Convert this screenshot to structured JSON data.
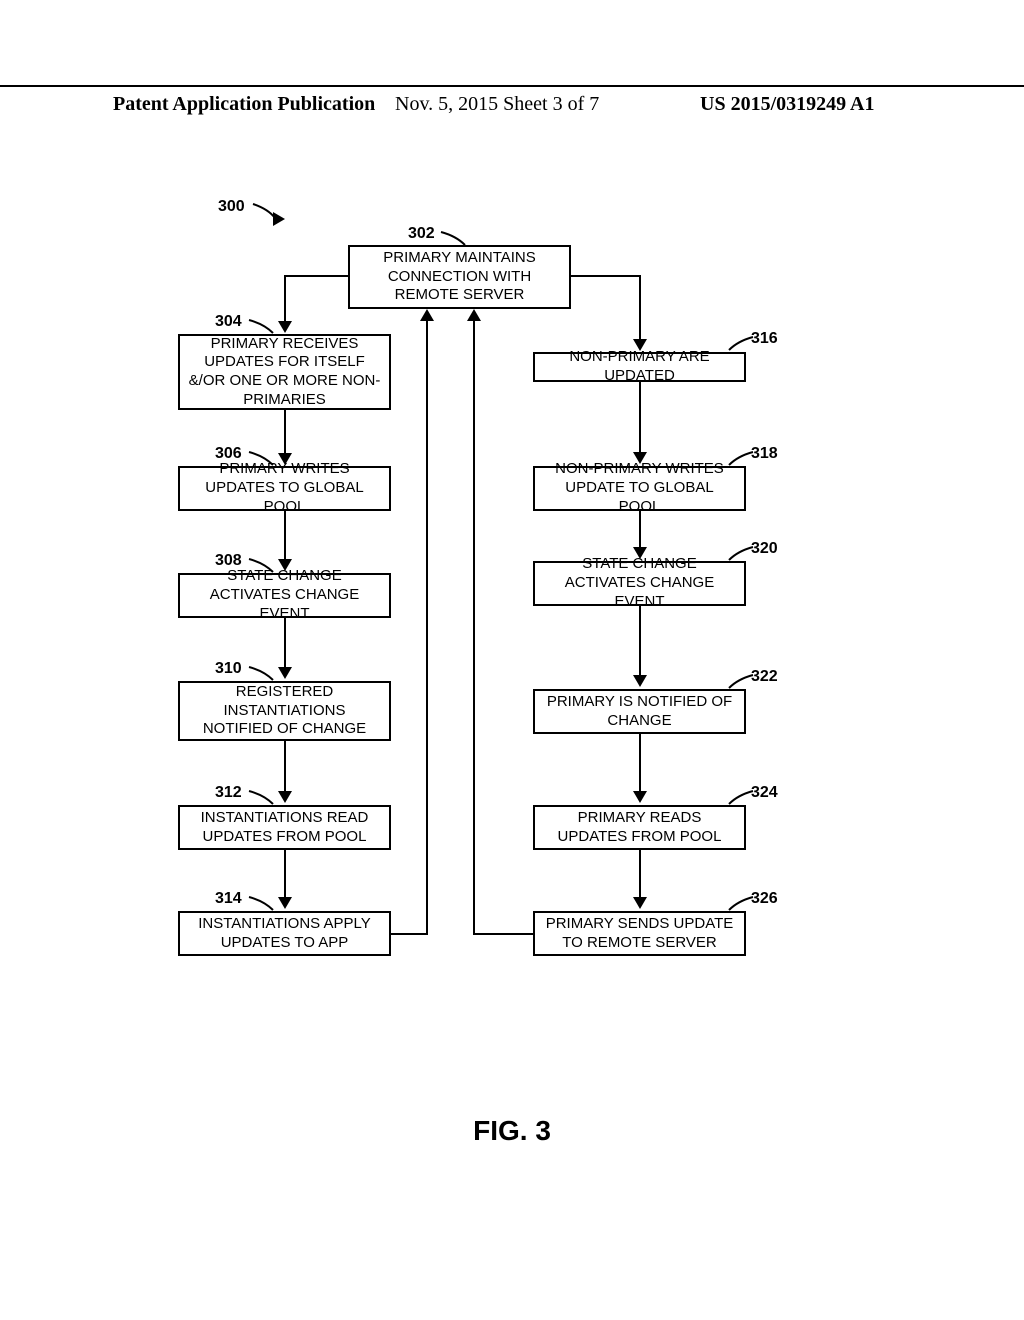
{
  "header": {
    "left": "Patent Application Publication",
    "mid": "Nov. 5, 2015   Sheet 3 of 7",
    "right": "US 2015/0319249 A1"
  },
  "labels": {
    "l300": "300",
    "l302": "302",
    "l304": "304",
    "l306": "306",
    "l308": "308",
    "l310": "310",
    "l312": "312",
    "l314": "314",
    "l316": "316",
    "l318": "318",
    "l320": "320",
    "l322": "322",
    "l324": "324",
    "l326": "326"
  },
  "boxes": {
    "b302": "PRIMARY MAINTAINS CONNECTION WITH REMOTE SERVER",
    "b304": "PRIMARY RECEIVES UPDATES FOR ITSELF &/OR ONE OR MORE NON-PRIMARIES",
    "b306": "PRIMARY WRITES UPDATES TO GLOBAL POOL",
    "b308": "STATE CHANGE ACTIVATES CHANGE EVENT",
    "b310": "REGISTERED INSTANTIATIONS NOTIFIED OF CHANGE",
    "b312": "INSTANTIATIONS READ UPDATES FROM POOL",
    "b314": "INSTANTIATIONS APPLY UPDATES TO APP",
    "b316": "NON-PRIMARY ARE UPDATED",
    "b318": "NON-PRIMARY WRITES UPDATE TO GLOBAL POOL",
    "b320": "STATE CHANGE ACTIVATES CHANGE EVENT",
    "b322": "PRIMARY IS NOTIFIED OF CHANGE",
    "b324": "PRIMARY READS UPDATES FROM POOL",
    "b326": "PRIMARY SENDS UPDATE TO REMOTE SERVER"
  },
  "caption": "FIG. 3",
  "chart_data": {
    "type": "flowchart",
    "title": "FIG. 3",
    "root_label_ref": "300",
    "root_node": "302",
    "nodes": [
      {
        "id": "302",
        "text": "PRIMARY MAINTAINS CONNECTION WITH REMOTE SERVER"
      },
      {
        "id": "304",
        "text": "PRIMARY RECEIVES UPDATES FOR ITSELF &/OR ONE OR MORE NON-PRIMARIES"
      },
      {
        "id": "306",
        "text": "PRIMARY WRITES UPDATES TO GLOBAL POOL"
      },
      {
        "id": "308",
        "text": "STATE CHANGE ACTIVATES CHANGE EVENT"
      },
      {
        "id": "310",
        "text": "REGISTERED INSTANTIATIONS NOTIFIED OF CHANGE"
      },
      {
        "id": "312",
        "text": "INSTANTIATIONS READ UPDATES FROM POOL"
      },
      {
        "id": "314",
        "text": "INSTANTIATIONS APPLY UPDATES TO APP"
      },
      {
        "id": "316",
        "text": "NON-PRIMARY ARE UPDATED"
      },
      {
        "id": "318",
        "text": "NON-PRIMARY WRITES UPDATE TO GLOBAL POOL"
      },
      {
        "id": "320",
        "text": "STATE CHANGE ACTIVATES CHANGE EVENT"
      },
      {
        "id": "322",
        "text": "PRIMARY IS NOTIFIED OF CHANGE"
      },
      {
        "id": "324",
        "text": "PRIMARY READS UPDATES FROM POOL"
      },
      {
        "id": "326",
        "text": "PRIMARY SENDS UPDATE TO REMOTE SERVER"
      }
    ],
    "edges": [
      {
        "from": "302",
        "to": "304"
      },
      {
        "from": "304",
        "to": "306"
      },
      {
        "from": "306",
        "to": "308"
      },
      {
        "from": "308",
        "to": "310"
      },
      {
        "from": "310",
        "to": "312"
      },
      {
        "from": "312",
        "to": "314"
      },
      {
        "from": "314",
        "to": "302",
        "note": "return to top"
      },
      {
        "from": "302",
        "to": "316"
      },
      {
        "from": "316",
        "to": "318"
      },
      {
        "from": "318",
        "to": "320"
      },
      {
        "from": "320",
        "to": "322"
      },
      {
        "from": "322",
        "to": "324"
      },
      {
        "from": "324",
        "to": "326"
      },
      {
        "from": "326",
        "to": "302",
        "note": "return to top"
      }
    ]
  }
}
